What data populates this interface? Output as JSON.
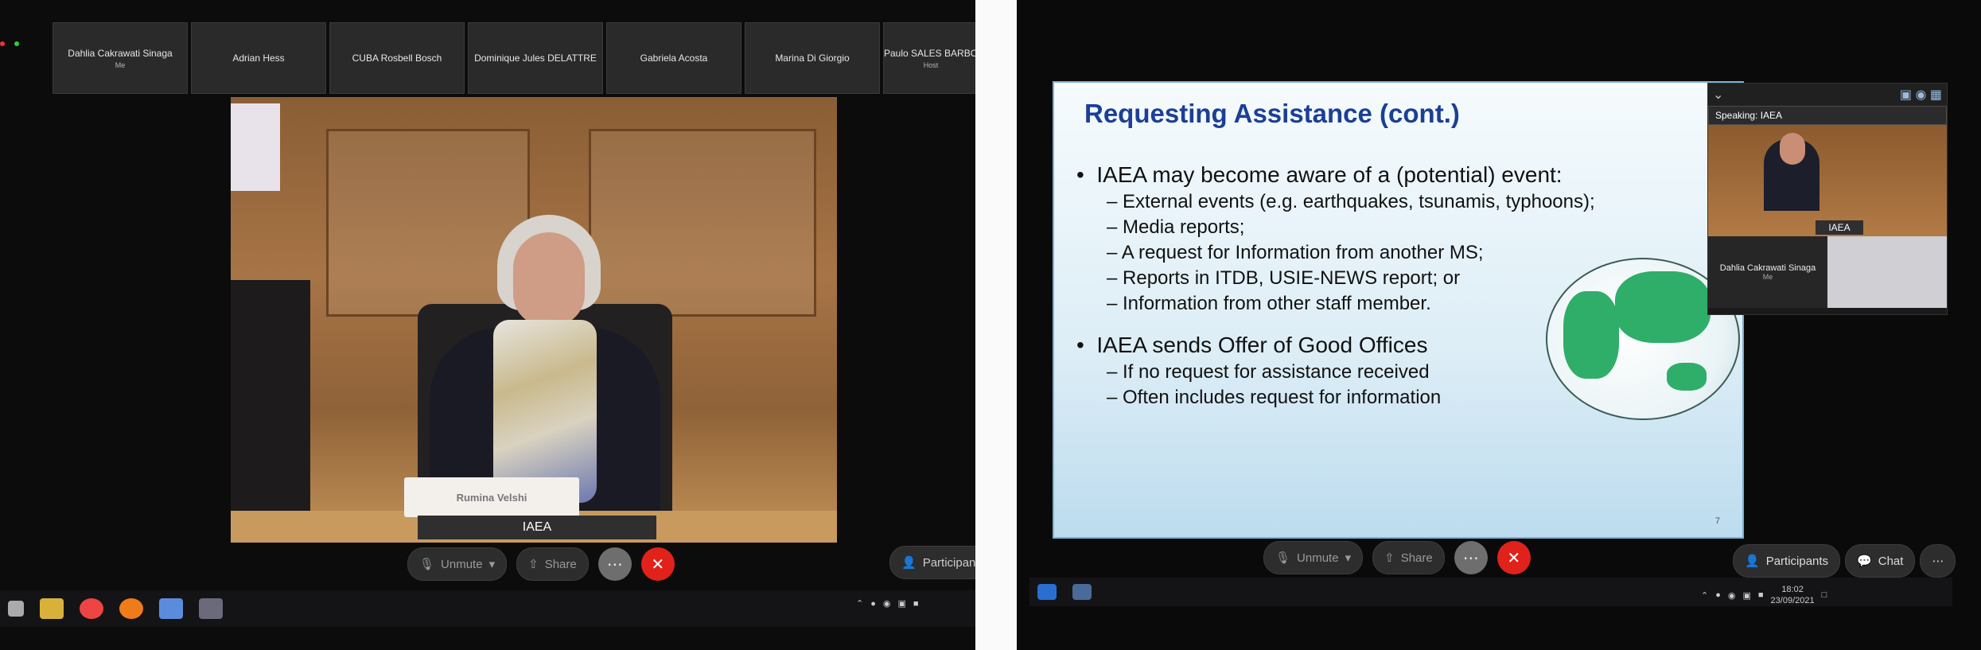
{
  "left": {
    "participants": [
      {
        "name": "Dahlia Cakrawati Sinaga",
        "role": "Me"
      },
      {
        "name": "Adrian Hess",
        "role": ""
      },
      {
        "name": "CUBA Rosbell Bosch",
        "role": ""
      },
      {
        "name": "Dominique Jules DELATTRE",
        "role": ""
      },
      {
        "name": "Gabriela Acosta",
        "role": ""
      },
      {
        "name": "Marina Di Giorgio",
        "role": ""
      },
      {
        "name": "Paulo SALES BARBO",
        "role": "Host"
      }
    ],
    "video": {
      "nameplate": "Rumina Velshi",
      "label": "IAEA"
    },
    "controls": {
      "unmute": "Unmute",
      "share": "Share",
      "more": "⋯",
      "end": "✕",
      "participants": "Participants"
    }
  },
  "right": {
    "slide": {
      "title": "Requesting Assistance (cont.)",
      "bullet1": "IAEA may become aware of a (potential) event:",
      "bullet1_items": [
        "External events (e.g. earthquakes, tsunamis, typhoons);",
        "Media reports;",
        "A request for Information from another MS;",
        "Reports in ITDB, USIE-NEWS report; or",
        "Information from other staff member."
      ],
      "bullet2": "IAEA sends Offer of Good Offices",
      "bullet2_items": [
        "If no request for assistance received",
        "Often includes request for information"
      ],
      "page": "7"
    },
    "float_panel": {
      "speaking": "Speaking: IAEA",
      "video_label": "IAEA",
      "self_name": "Dahlia Cakrawati Sinaga",
      "self_role": "Me"
    },
    "controls": {
      "unmute": "Unmute",
      "share": "Share",
      "more": "⋯",
      "end": "✕",
      "participants": "Participants",
      "chat": "Chat",
      "overflow": "⋯"
    },
    "clock": {
      "time": "18:02",
      "date": "23/09/2021"
    }
  },
  "colors": {
    "end_red": "#e1221a",
    "slide_title_blue": "#1c3f96",
    "globe_green": "#2fae6a"
  }
}
